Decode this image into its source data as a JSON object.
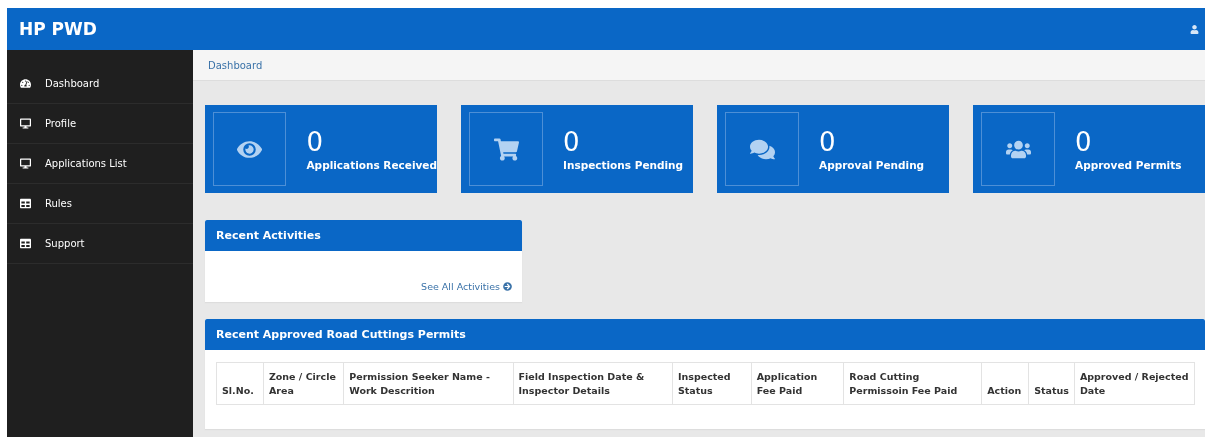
{
  "header": {
    "title": "HP PWD"
  },
  "sidebar": {
    "items": [
      {
        "label": "Dashboard"
      },
      {
        "label": "Profile"
      },
      {
        "label": "Applications List"
      },
      {
        "label": "Rules"
      },
      {
        "label": "Support"
      }
    ]
  },
  "breadcrumb": "Dashboard",
  "stats": [
    {
      "count": "0",
      "label": "Applications Received"
    },
    {
      "count": "0",
      "label": "Inspections Pending"
    },
    {
      "count": "0",
      "label": "Approval Pending"
    },
    {
      "count": "0",
      "label": "Approved Permits"
    }
  ],
  "recent_activities": {
    "title": "Recent Activities",
    "link": "See All Activities"
  },
  "permits": {
    "title": "Recent Approved Road Cuttings Permits",
    "columns": [
      "Sl.No.",
      "Zone / Circle Area",
      "Permission Seeker Name - Work Descrition",
      "Field Inspection Date & Inspector Details",
      "Inspected Status",
      "Application Fee Paid",
      "Road Cutting Permissoin Fee Paid",
      "Action",
      "Status",
      "Approved / Rejected Date"
    ]
  }
}
